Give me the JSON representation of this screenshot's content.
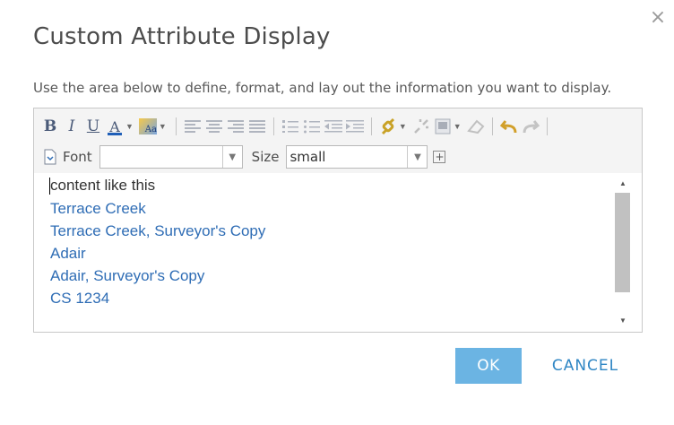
{
  "dialog": {
    "title": "Custom Attribute Display",
    "description": "Use the area below to define, format, and lay out the information you want to display.",
    "close_glyph": "×"
  },
  "toolbar": {
    "bold_glyph": "B",
    "italic_glyph": "I",
    "underline_glyph": "U",
    "font_color_glyph": "A",
    "highlight_glyph": "Aa",
    "caret_glyph": "▼",
    "font_label": "Font",
    "font_value": "",
    "size_label": "Size",
    "size_value": "small",
    "icons": [
      "bold-icon",
      "italic-icon",
      "underline-icon",
      "font-color-icon",
      "highlight-color-icon",
      "align-left-icon",
      "align-center-icon",
      "align-right-icon",
      "justify-icon",
      "numbered-list-icon",
      "bullet-list-icon",
      "outdent-icon",
      "indent-icon",
      "link-icon",
      "unlink-icon",
      "insert-image-icon",
      "eraser-icon",
      "undo-icon",
      "redo-icon",
      "source-icon",
      "expand-plus-icon"
    ],
    "accent_color": "#1f5fb8"
  },
  "content": {
    "lines": [
      "content like this",
      "Terrace Creek",
      "Terrace Creek, Surveyor's Copy",
      "Adair",
      "Adair, Surveyor's Copy",
      "CS 1234"
    ],
    "link_color": "#2f6db5"
  },
  "buttons": {
    "ok": "OK",
    "cancel": "CANCEL",
    "ok_color": "#6bb4e3",
    "cancel_color": "#2f86c4"
  }
}
